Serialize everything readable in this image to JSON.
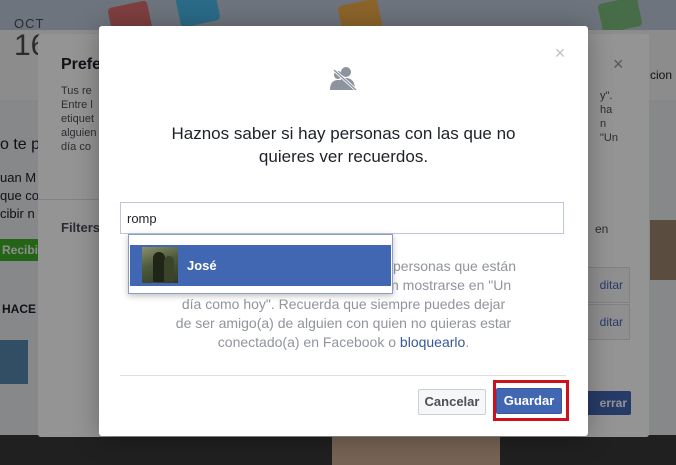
{
  "background": {
    "date_month": "OCT",
    "date_day": "16",
    "left_text_1": "o te p",
    "left_text_2": "uan M",
    "left_text_3": "que co",
    "left_text_4": "cibir n",
    "left_button": "Recibi",
    "left_text_5": "HACE",
    "right_text_1": "cion"
  },
  "preferences_dialog": {
    "title": "Prefe",
    "description_lines": [
      "Tus re",
      "Entre l",
      "etiquet",
      "alguien",
      "día co"
    ],
    "filters_label": "Filters",
    "right_text_lines": [
      "y\".",
      "ha",
      "n",
      "\"Un"
    ],
    "right_en": "en",
    "edit_label_1": "ditar",
    "edit_label_2": "ditar",
    "close_glyph": "×",
    "bottom_button": "errar"
  },
  "dialog": {
    "close_glyph": "×",
    "header_icon": "people-block-icon",
    "heading_line_1": "Haznos saber si hay personas con las que no",
    "heading_line_2": "quieres ver recuerdos.",
    "search_value": "romp",
    "body_line_1": "personas que están",
    "body_line_2": "n mostrarse en \"Un",
    "body_line_3": "día como hoy\". Recuerda que siempre puedes dejar",
    "body_line_4": "de ser amigo(a) de alguien con quien no quieras estar",
    "body_line_5_prefix": "conectado(a) en Facebook o ",
    "body_link": "bloquearlo",
    "body_line_5_suffix": ".",
    "cancel_label": "Cancelar",
    "save_label": "Guardar"
  },
  "typeahead": {
    "items": [
      {
        "name": "José"
      }
    ]
  },
  "colors": {
    "brand_blue": "#4267b2",
    "highlight_red": "#d0111b",
    "link_blue": "#365899"
  }
}
